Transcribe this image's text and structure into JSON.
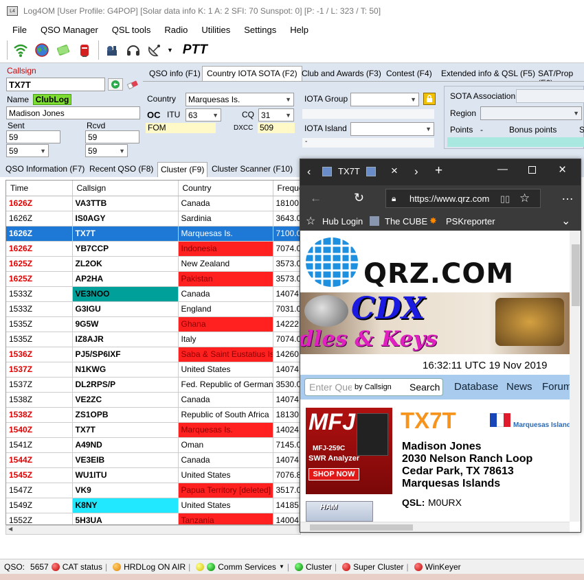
{
  "window": {
    "title": "Log4OM [User Profile: G4POP] [Solar data info K: 1 A: 2 SFI: 70 Sunspot: 0] [P: -1 / L: 323 / T: 50]"
  },
  "menu": [
    "File",
    "QSO Manager",
    "QSL tools",
    "Radio",
    "Utilities",
    "Settings",
    "Help"
  ],
  "toolbar": {
    "ptt_label": "PTT"
  },
  "entry": {
    "callsign_label": "Callsign",
    "callsign_value": "TX7T",
    "name_label": "Name",
    "clublog_badge": "ClubLog",
    "name_value": "Madison Jones",
    "sent_label": "Sent",
    "rcvd_label": "Rcvd",
    "sent_value": "59",
    "rcvd_value": "59",
    "sent_combo": "59",
    "rcvd_combo": "59"
  },
  "tabs": [
    "QSO info (F1)",
    "Country IOTA SOTA (F2)",
    "Club and Awards (F3)",
    "Contest (F4)",
    "Extended info & QSL (F5)",
    "SAT/Prop (F6)"
  ],
  "country_tab": {
    "country_label": "Country",
    "country_value": "Marquesas Is.",
    "oc_label": "OC",
    "itu_label": "ITU",
    "itu_value": "63",
    "cq_label": "CQ",
    "cq_value": "31",
    "prefix_value": "FOM",
    "dxcc_label": "DXCC",
    "dxcc_value": "509",
    "iota_group_label": "IOTA Group",
    "iota_island_label": "IOTA Island",
    "iota_dash": "-",
    "sota_label": "SOTA Association",
    "region_label": "Region",
    "points_label": "Points",
    "points_value": "-",
    "bonus_label": "Bonus points",
    "bonus_trunc": "S"
  },
  "bottom_tabs": [
    "QSO Information (F7)",
    "Recent QSO (F8)",
    "Cluster (F9)",
    "Cluster Scanner (F10)"
  ],
  "grid": {
    "headers": [
      "Time",
      "Callsign",
      "Country",
      "Freque"
    ],
    "rows": [
      {
        "time": "1626Z",
        "call": "VA3TTB",
        "country": "Canada",
        "freq": "18100.0"
      },
      {
        "time": "1626Z",
        "call": "IS0AGY",
        "country": "Sardinia",
        "freq": "3643.0"
      },
      {
        "time": "1626Z",
        "call": "TX7T",
        "country": "Marquesas Is.",
        "freq": "7100.0"
      },
      {
        "time": "1626Z",
        "call": "YB7CCP",
        "country": "Indonesia",
        "freq": "7074.0"
      },
      {
        "time": "1625Z",
        "call": "ZL2OK",
        "country": "New Zealand",
        "freq": "3573.0"
      },
      {
        "time": "1625Z",
        "call": "AP2HA",
        "country": "Pakistan",
        "freq": "3573.0"
      },
      {
        "time": "1533Z",
        "call": "VE3NOO",
        "country": "Canada",
        "freq": "14074.0"
      },
      {
        "time": "1533Z",
        "call": "G3IGU",
        "country": "England",
        "freq": "7031.0"
      },
      {
        "time": "1535Z",
        "call": "9G5W",
        "country": "Ghana",
        "freq": "14222.0"
      },
      {
        "time": "1535Z",
        "call": "IZ8AJR",
        "country": "Italy",
        "freq": "7074.0"
      },
      {
        "time": "1536Z",
        "call": "PJ5/SP6IXF",
        "country": "Saba & Saint Eustatius Is.",
        "freq": "14260.0"
      },
      {
        "time": "1537Z",
        "call": "N1KWG",
        "country": "United States",
        "freq": "14074.0"
      },
      {
        "time": "1537Z",
        "call": "DL2RPS/P",
        "country": "Fed. Republic of Germany",
        "freq": "3530.0"
      },
      {
        "time": "1538Z",
        "call": "VE2ZC",
        "country": "Canada",
        "freq": "14074.0"
      },
      {
        "time": "1538Z",
        "call": "ZS1OPB",
        "country": "Republic of South Africa",
        "freq": "18130.0"
      },
      {
        "time": "1540Z",
        "call": "TX7T",
        "country": "Marquesas Is.",
        "freq": "14024.0"
      },
      {
        "time": "1541Z",
        "call": "A49ND",
        "country": "Oman",
        "freq": "7145.0"
      },
      {
        "time": "1544Z",
        "call": "VE3EIB",
        "country": "Canada",
        "freq": "14074.0"
      },
      {
        "time": "1545Z",
        "call": "WU1ITU",
        "country": "United States",
        "freq": "7076.8"
      },
      {
        "time": "1547Z",
        "call": "VK9",
        "country": "Papua Territory [deleted]",
        "freq": "3517.0"
      },
      {
        "time": "1549Z",
        "call": "K8NY",
        "country": "United States",
        "freq": "14185.0"
      },
      {
        "time": "1552Z",
        "call": "5H3UA",
        "country": "Tanzania",
        "freq": "14004.0"
      }
    ]
  },
  "browser": {
    "tab1_title": "TX7T",
    "url": "https://www.qrz.com",
    "favorites": [
      "Hub Login",
      "The CUBE",
      "PSKreporter"
    ],
    "logo_text": "QRZ.COM",
    "banner_title": "CDX",
    "banner_sub": "dles & Keys",
    "datetime": "16:32:11 UTC 19 Nov 2019",
    "search_placeholder": "Enter Que",
    "search_mode": "by Callsign",
    "search_button": "Search",
    "nav": [
      "Database",
      "News",
      "Forum"
    ],
    "ad_brand": "MFJ",
    "ad_model": "MFJ-259C",
    "ad_desc": "SWR Analyzer",
    "ad_cta": "SHOP NOW",
    "ad2_text": "HAM",
    "callsign": "TX7T",
    "flag_country": "Marquesas Island",
    "name": "Madison Jones",
    "address1": "2030 Nelson Ranch Loop",
    "address2": "Cedar Park, TX 78613",
    "address3": "Marquesas Islands",
    "qsl_label": "QSL:",
    "qsl_value": "M0URX"
  },
  "status": {
    "qso_label": "QSO:",
    "qso_count": "5657",
    "items": [
      "CAT status",
      "HRDLog ON AIR",
      "Comm Services",
      "Cluster",
      "Super Cluster",
      "WinKeyer"
    ]
  },
  "colors": {
    "selected_row": "#1e78d6",
    "alert_red": "#ff2020",
    "panel_bg": "#dde5f0",
    "qrz_orange": "#f7941d"
  }
}
